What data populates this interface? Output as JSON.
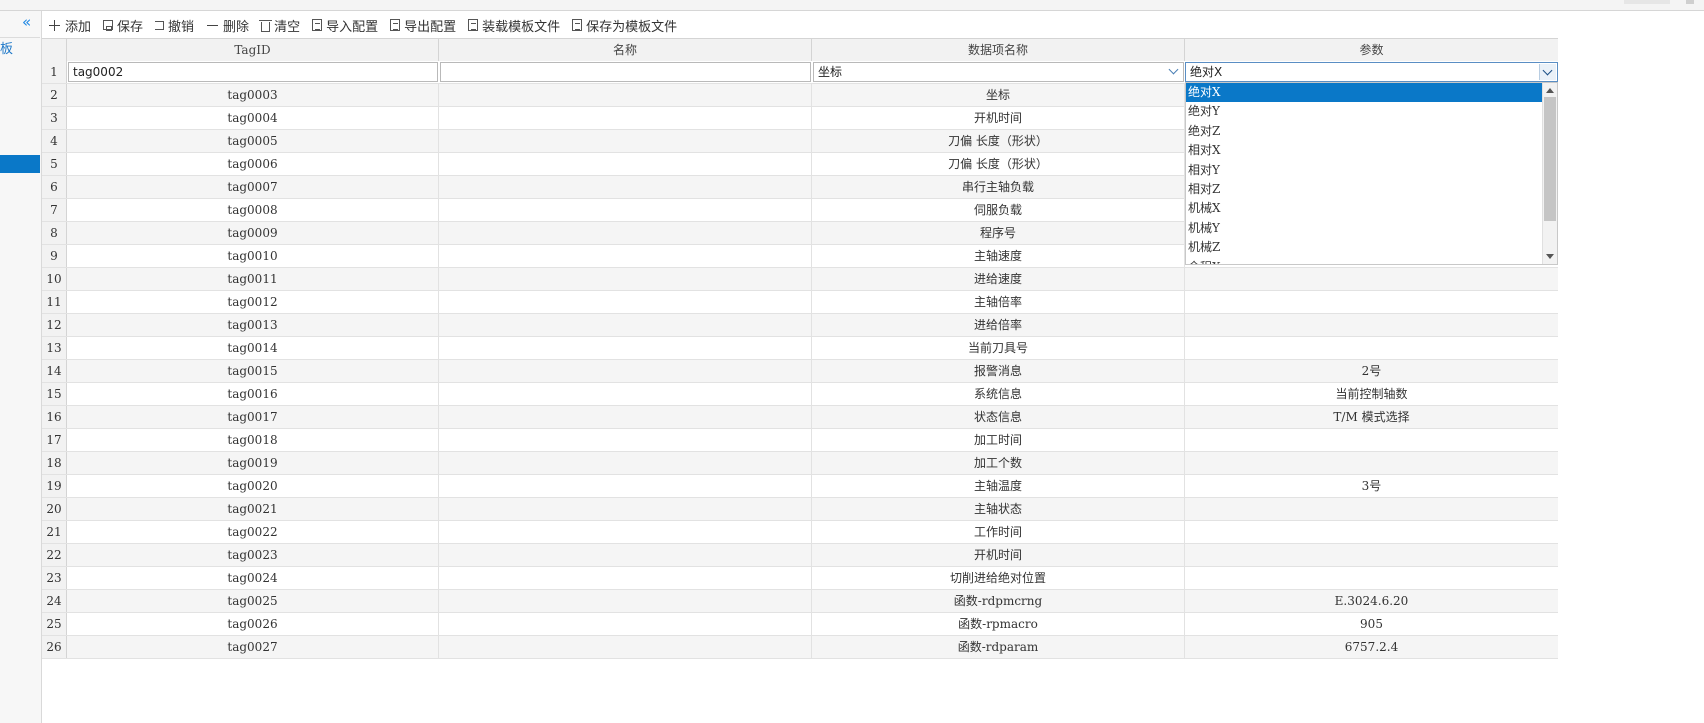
{
  "sidebar": {
    "collapse_glyph": "«",
    "label": "板"
  },
  "toolbar": {
    "add": "添加",
    "save": "保存",
    "undo": "撤销",
    "delete": "删除",
    "clear": "清空",
    "import_config": "导入配置",
    "export_config": "导出配置",
    "load_template": "装载模板文件",
    "save_template": "保存为模板文件"
  },
  "columns": {
    "tagid": "TagID",
    "name": "名称",
    "data_item": "数据项名称",
    "param": "参数"
  },
  "edit_row": {
    "num": "1",
    "tagid": "tag0002",
    "name": "",
    "data_item": "坐标",
    "param": "绝对X"
  },
  "rows": [
    {
      "num": "2",
      "tagid": "tag0003",
      "name": "",
      "data_item": "坐标",
      "param": ""
    },
    {
      "num": "3",
      "tagid": "tag0004",
      "name": "",
      "data_item": "开机时间",
      "param": ""
    },
    {
      "num": "4",
      "tagid": "tag0005",
      "name": "",
      "data_item": "刀偏 长度（形状）",
      "param": ""
    },
    {
      "num": "5",
      "tagid": "tag0006",
      "name": "",
      "data_item": "刀偏 长度（形状）",
      "param": ""
    },
    {
      "num": "6",
      "tagid": "tag0007",
      "name": "",
      "data_item": "串行主轴负载",
      "param": ""
    },
    {
      "num": "7",
      "tagid": "tag0008",
      "name": "",
      "data_item": "伺服负载",
      "param": ""
    },
    {
      "num": "8",
      "tagid": "tag0009",
      "name": "",
      "data_item": "程序号",
      "param": ""
    },
    {
      "num": "9",
      "tagid": "tag0010",
      "name": "",
      "data_item": "主轴速度",
      "param": ""
    },
    {
      "num": "10",
      "tagid": "tag0011",
      "name": "",
      "data_item": "进给速度",
      "param": ""
    },
    {
      "num": "11",
      "tagid": "tag0012",
      "name": "",
      "data_item": "主轴倍率",
      "param": ""
    },
    {
      "num": "12",
      "tagid": "tag0013",
      "name": "",
      "data_item": "进给倍率",
      "param": ""
    },
    {
      "num": "13",
      "tagid": "tag0014",
      "name": "",
      "data_item": "当前刀具号",
      "param": ""
    },
    {
      "num": "14",
      "tagid": "tag0015",
      "name": "",
      "data_item": "报警消息",
      "param": "2号"
    },
    {
      "num": "15",
      "tagid": "tag0016",
      "name": "",
      "data_item": "系统信息",
      "param": "当前控制轴数"
    },
    {
      "num": "16",
      "tagid": "tag0017",
      "name": "",
      "data_item": "状态信息",
      "param": "T/M 模式选择"
    },
    {
      "num": "17",
      "tagid": "tag0018",
      "name": "",
      "data_item": "加工时间",
      "param": ""
    },
    {
      "num": "18",
      "tagid": "tag0019",
      "name": "",
      "data_item": "加工个数",
      "param": ""
    },
    {
      "num": "19",
      "tagid": "tag0020",
      "name": "",
      "data_item": "主轴温度",
      "param": "3号"
    },
    {
      "num": "20",
      "tagid": "tag0021",
      "name": "",
      "data_item": "主轴状态",
      "param": ""
    },
    {
      "num": "21",
      "tagid": "tag0022",
      "name": "",
      "data_item": "工作时间",
      "param": ""
    },
    {
      "num": "22",
      "tagid": "tag0023",
      "name": "",
      "data_item": "开机时间",
      "param": ""
    },
    {
      "num": "23",
      "tagid": "tag0024",
      "name": "",
      "data_item": "切削进给绝对位置",
      "param": ""
    },
    {
      "num": "24",
      "tagid": "tag0025",
      "name": "",
      "data_item": "函数-rdpmcrng",
      "param": "E.3024.6.20"
    },
    {
      "num": "25",
      "tagid": "tag0026",
      "name": "",
      "data_item": "函数-rpmacro",
      "param": "905"
    },
    {
      "num": "26",
      "tagid": "tag0027",
      "name": "",
      "data_item": "函数-rdparam",
      "param": "6757.2.4"
    }
  ],
  "dropdown": {
    "options": [
      "绝对X",
      "绝对Y",
      "绝对Z",
      "相对X",
      "相对Y",
      "相对Z",
      "机械X",
      "机械Y",
      "机械Z",
      "余程X"
    ],
    "selected_index": 0
  },
  "colors": {
    "accent": "#0a78c8",
    "header_bg": "#f2f2f2",
    "row_alt": "#f5f5f5",
    "border": "#d4d4d4"
  }
}
